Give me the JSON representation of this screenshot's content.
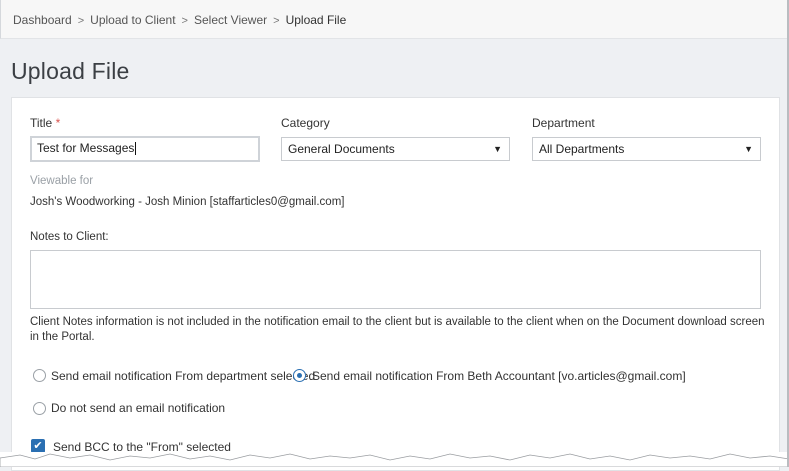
{
  "breadcrumb": {
    "items": [
      "Dashboard",
      "Upload to Client",
      "Select Viewer"
    ],
    "current": "Upload File",
    "separator": ">"
  },
  "page": {
    "title": "Upload File"
  },
  "form": {
    "title_label": "Title",
    "required_marker": "*",
    "title_value": "Test for Messages",
    "category_label": "Category",
    "category_value": "General Documents",
    "department_label": "Department",
    "department_value": "All Departments",
    "viewable_label": "Viewable for",
    "viewable_value": "Josh's Woodworking - Josh Minion [staffarticles0@gmail.com]",
    "notes_label": "Notes to Client:",
    "notes_value": "",
    "notes_info": "Client Notes information is not included in the notification email to the client but is available to the client when on the Document download screen in the Portal.",
    "radio_department": "Send email notification From department selected",
    "radio_accountant": "Send email notification From Beth Accountant [vo.articles@gmail.com]",
    "radio_none": "Do not send an email notification",
    "selected_radio": "accountant",
    "bcc_label": "Send BCC to the \"From\" selected",
    "bcc_checked": true
  },
  "icons": {
    "dropdown": "chevron-down-icon",
    "check": "check-icon"
  },
  "colors": {
    "accent": "#2a6fb2",
    "required": "#d9534f",
    "muted": "#9aa0a6"
  }
}
